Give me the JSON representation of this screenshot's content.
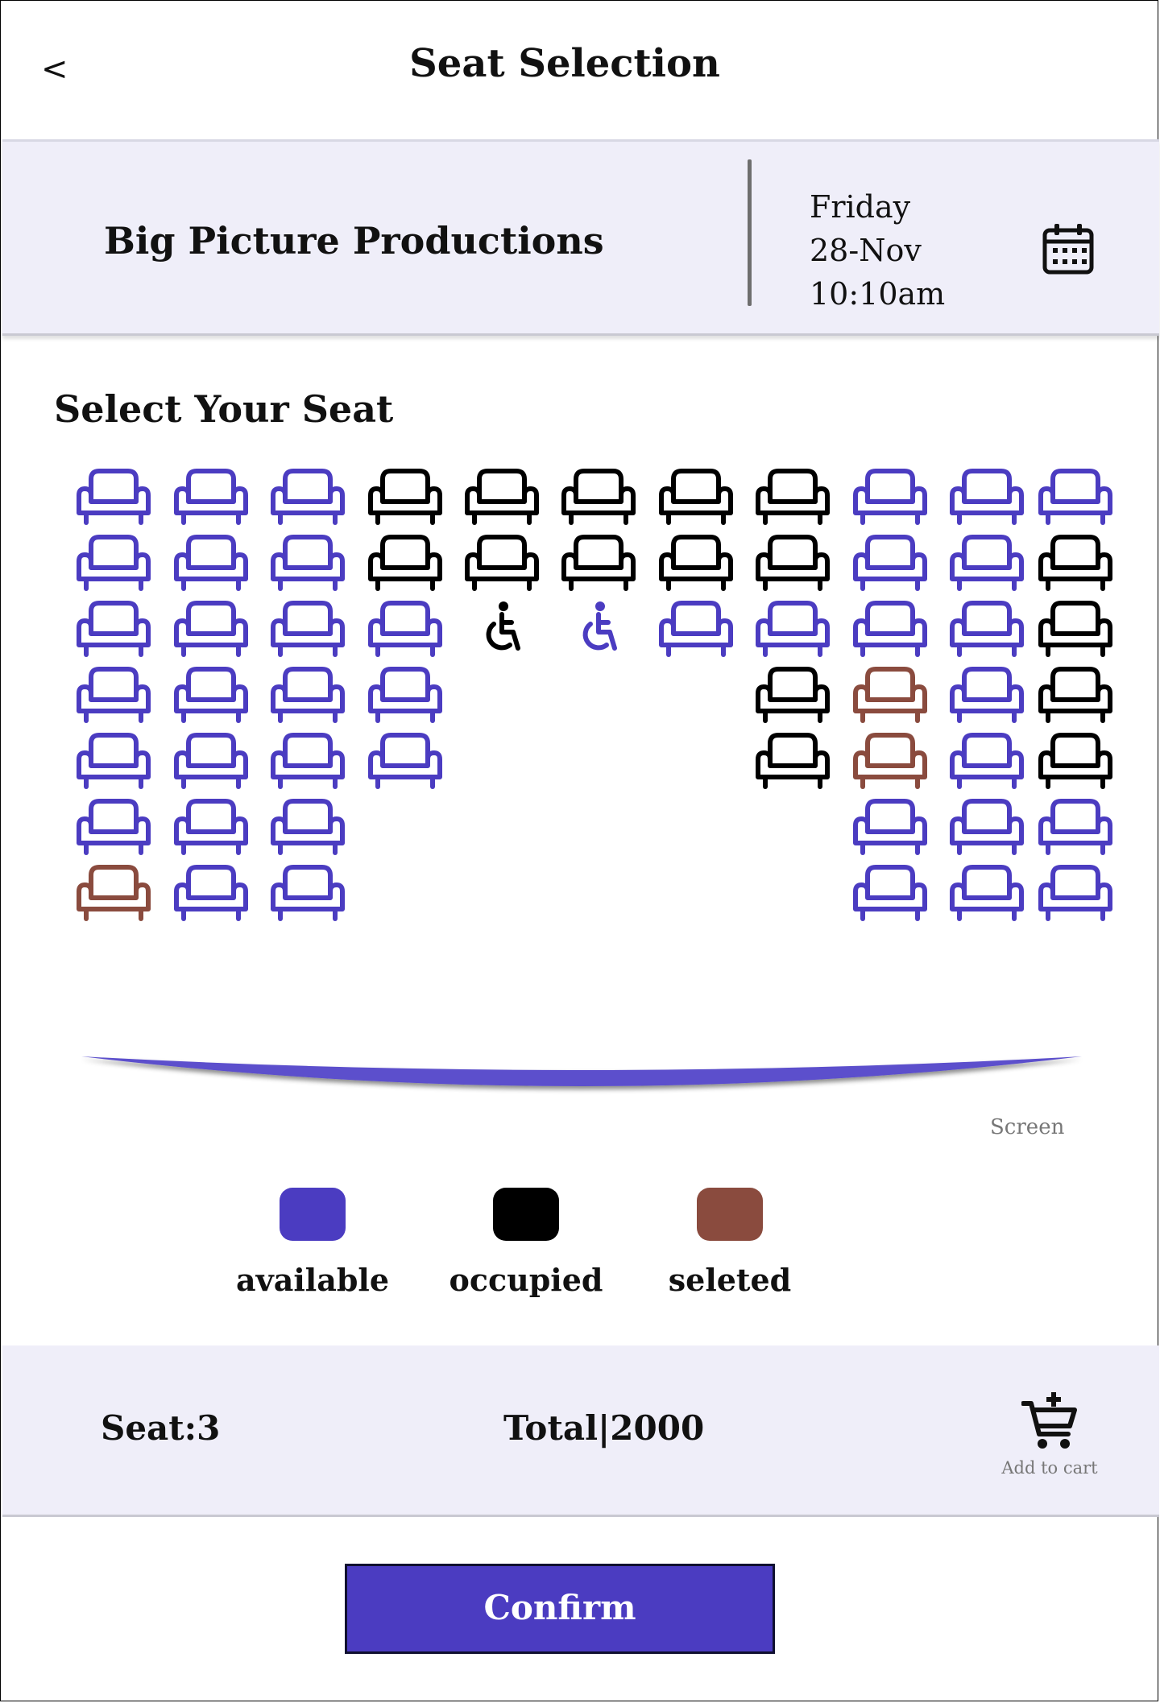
{
  "header": {
    "back_label": "<",
    "title": "Seat Selection"
  },
  "event": {
    "company": "Big Picture Productions",
    "day": "Friday",
    "date": "28-Nov",
    "time": "10:10am",
    "calendar_icon": "calendar-icon"
  },
  "section_title": "Select Your Seat",
  "colors": {
    "available": "#4b3cc1",
    "occupied": "#000000",
    "selected": "#8a4b3e",
    "accent": "#4b3cc1",
    "panel_bg": "#efeef9"
  },
  "seat_map": {
    "columns": 11,
    "rows": [
      [
        "available",
        "available",
        "available",
        "occupied",
        "occupied",
        "occupied",
        "occupied",
        "occupied",
        "available",
        "available",
        "available"
      ],
      [
        "available",
        "available",
        "available",
        "occupied",
        "occupied",
        "occupied",
        "occupied",
        "occupied",
        "available",
        "available",
        "occupied"
      ],
      [
        "available",
        "available",
        "available",
        "available",
        "wheelchair-occupied",
        "wheelchair-available",
        "available",
        "available",
        "available",
        "available",
        "occupied"
      ],
      [
        "available",
        "available",
        "available",
        "available",
        null,
        null,
        null,
        "occupied",
        "selected",
        "available",
        "occupied"
      ],
      [
        "available",
        "available",
        "available",
        "available",
        null,
        null,
        null,
        "occupied",
        "selected",
        "available",
        "occupied"
      ],
      [
        "available",
        "available",
        "available",
        null,
        null,
        null,
        null,
        null,
        "available",
        "available",
        "available"
      ],
      [
        "selected",
        "available",
        "available",
        null,
        null,
        null,
        null,
        null,
        "available",
        "available",
        "available"
      ]
    ]
  },
  "screen": {
    "label": "Screen"
  },
  "legend": [
    {
      "label": "available",
      "status": "available"
    },
    {
      "label": "occupied",
      "status": "occupied"
    },
    {
      "label": "seleted",
      "status": "selected"
    }
  ],
  "summary": {
    "seat_label": "Seat:3",
    "total_label": "Total|2000",
    "cart_label": "Add to cart",
    "cart_icon": "add-to-cart-icon"
  },
  "confirm_label": "Confirm"
}
